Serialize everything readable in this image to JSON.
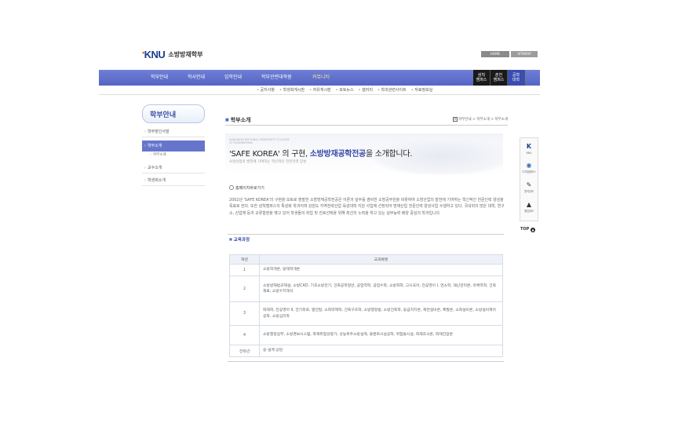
{
  "logo": {
    "mark": "KNU",
    "sub": "소방방재학부"
  },
  "util": {
    "home": "HOME",
    "sitemap": "SITEMAP"
  },
  "nav": {
    "items": [
      "학부안내",
      "학사안내",
      "입학안내",
      "학부관련대학원",
      "커뮤니티"
    ],
    "active": 4,
    "campus": [
      {
        "l1": "삼척",
        "l2": "캠퍼스"
      },
      {
        "l1": "춘천",
        "l2": "캠퍼스"
      },
      {
        "l1": "공학",
        "l2": "대학"
      }
    ],
    "sub": [
      "공지사항",
      "학생회게시판",
      "자유게시판",
      "포토뉴스",
      "갤러리",
      "학과관련사이트",
      "자료정보실"
    ]
  },
  "sidebar": {
    "title": "학부안내",
    "items": [
      "학부장인사말",
      "학부소개",
      "학부소개",
      "교수소개",
      "학생회소개"
    ]
  },
  "header": {
    "title": "학부소개",
    "breadcrumb": "학부안내 > 학부소개 > 학부소개"
  },
  "banner": {
    "small": "KANGWON NATIONAL UNIVERSITY COLLEGE OF ENGINEERING",
    "pre": "'SAFE KOREA' 의 구현,",
    "highlight": "소방방재공학전공",
    "post": "을 소개합니다.",
    "desc": "소방산업의 발전에 기여하는 혁신적인 전문인력 양성"
  },
  "homelink": "홈페이지바로가기",
  "intro": "2002년 'SAFE KOREA'의 구현을 모토로 출발한 소방방재공학전공은 이론과 실무를 겸비한 소방공무원을 비롯하여 소방산업의 발전에 기여하는 혁신적인 전문인력 양성을 목표로 한다. 또한 삼척캠퍼스의 특성화 학과이며 강원도 지역전략산업 육성대학 지원 사업에 선정되어 방재산업 전문인력 양성사업 수행하고 있다. 국내외의 많은 대학, 연구소, 산업체 등과 교류협정을 맺고 있어 학생들의 취업 및 진로선택을 위해 최선의 노력을 하고 있는 실무능력 배양 중심의 학과입니다.",
  "curriculum": {
    "title": "교육과정",
    "headers": [
      "학년",
      "교과목명"
    ],
    "rows": [
      {
        "year": "1",
        "subjects": "소방학개론, 방재학개론"
      },
      {
        "year": "2",
        "subjects": "소방방재법규해설, 소방CAD, 기초소방전기, 건축공학일반, 공업역학, 공업수학, 소방화학, 고시국어, 전공영어 I, 연소학, 재난관리론, 유체역학, 건축재료, 소방수치해석"
      },
      {
        "year": "3",
        "subjects": "화재학, 전공영어 II, 전기회로, 열전달, 소화약제학, 건축구조학, 소방행정법, 소방건축학, 응급처치론, 재연설비론, 폭발론, 소화설비론, 소방설비제어공학, 소방심리학"
      },
      {
        "year": "4",
        "subjects": "소방행정실무, 소방경보시스템, 화재위험성평가, 성능위주소방설계, 플랜트시설공학, 위험물시설, 화재조사론, 화재진압론"
      },
      {
        "year": "전학년",
        "subjects": "응·설계 상담"
      }
    ]
  },
  "quick": [
    "KNU",
    "디지털캠퍼스",
    "원격강좌",
    "졸업정보"
  ],
  "top_label": "TOP"
}
